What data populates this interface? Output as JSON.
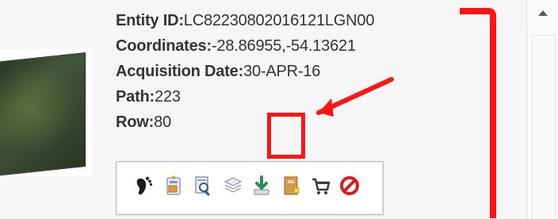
{
  "scene_details": {
    "thumbnail_alt": "Satellite scene thumbnail",
    "fields": [
      {
        "key": "Entity ID:",
        "value": "LC82230802016121LGN00"
      },
      {
        "key": "Coordinates:",
        "value": "-28.86955,-54.13621"
      },
      {
        "key": "Acquisition Date:",
        "value": "30-APR-16"
      },
      {
        "key": "Path:",
        "value": "223"
      },
      {
        "key": "Row:",
        "value": "80"
      }
    ]
  },
  "toolbar": {
    "icons": [
      "footprint-icon",
      "metadata-icon",
      "browse-overlay-icon",
      "compare-icon",
      "download-icon",
      "bulk-download-icon",
      "cart-icon",
      "exclude-icon"
    ]
  },
  "annotations": {
    "color": "#ff1414"
  },
  "scrollbar": {
    "up_arrow": "arrow-up-icon"
  }
}
